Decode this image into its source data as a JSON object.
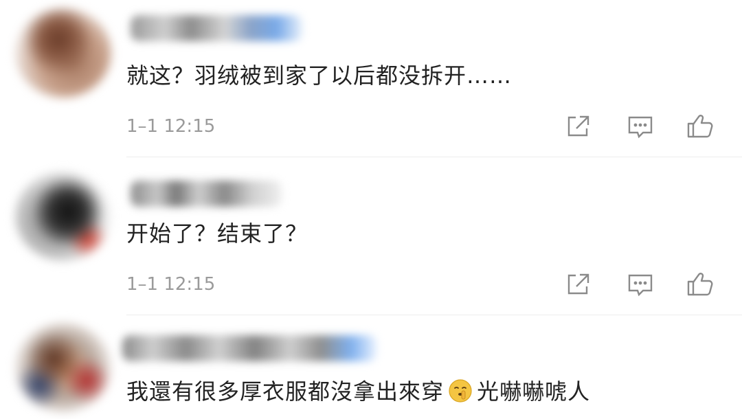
{
  "comments": [
    {
      "text": "就这？羽绒被到家了以后都没拆开……",
      "time": "1–1 12:15",
      "actions": [
        "share-icon",
        "comment-icon",
        "like-icon"
      ]
    },
    {
      "text": "开始了？结束了？",
      "time": "1–1 12:15",
      "actions": [
        "share-icon",
        "comment-icon",
        "like-icon"
      ]
    },
    {
      "text_before": "我還有很多厚衣服都沒拿出來穿",
      "emoji": "shushing-face-emoji",
      "text_after": "光嚇嚇唬人"
    }
  ],
  "colors": {
    "text": "#222222",
    "timestamp": "#9a9a9a",
    "icon": "#8a8a8a",
    "divider": "#ececec"
  }
}
